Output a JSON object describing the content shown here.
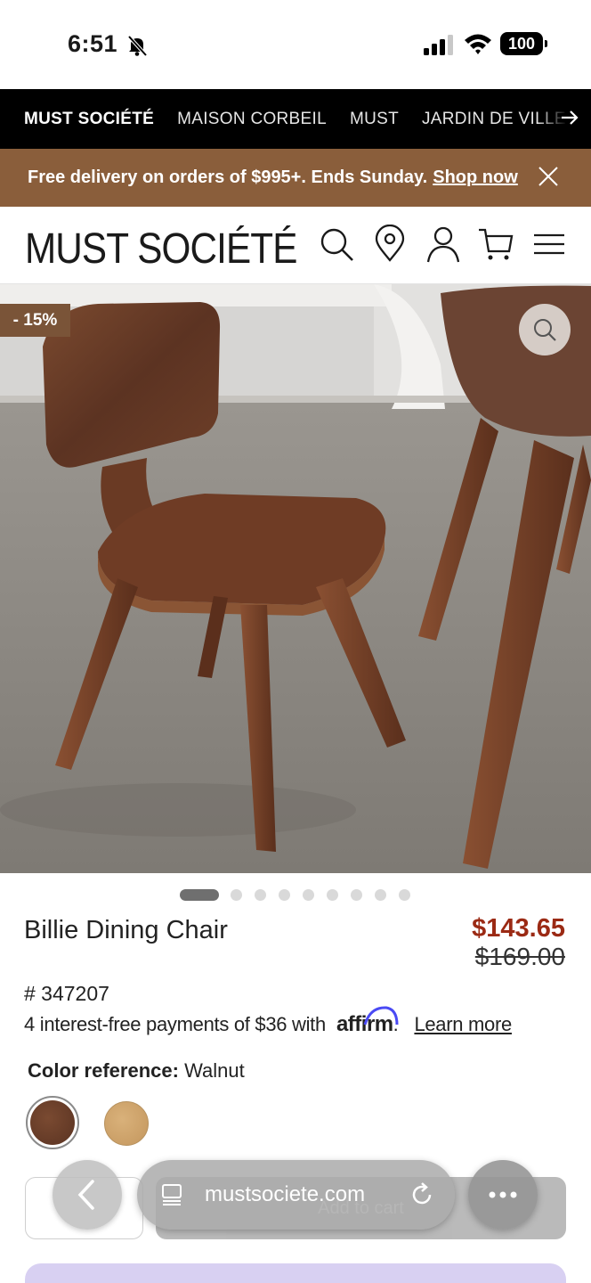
{
  "status_bar": {
    "time": "6:51",
    "battery": "100"
  },
  "brand_nav": {
    "items": [
      "MUST SOCIÉTÉ",
      "MAISON CORBEIL",
      "MUST",
      "JARDIN DE VILLE"
    ]
  },
  "promo": {
    "text": "Free delivery on orders of $995+. Ends Sunday.",
    "link": "Shop now"
  },
  "header": {
    "logo": "MUST SOCIÉTÉ"
  },
  "hero": {
    "badge": "- 15%",
    "image_count": 10,
    "active_index": 0
  },
  "product": {
    "name": "Billie Dining Chair",
    "price": "$143.65",
    "original_price": "$169.00",
    "sku": "# 347207",
    "payments_text": "4 interest-free payments of $36 with",
    "affirm_logo": "affirm",
    "learn_more": "Learn more",
    "color_label": "Color reference:",
    "color_value": "Walnut",
    "swatches": [
      {
        "name": "Walnut",
        "color": "#6a3e29",
        "selected": true
      },
      {
        "name": "Oak",
        "color": "#d3aa72",
        "selected": false
      }
    ]
  },
  "actions": {
    "add_to_cart": "Add to cart"
  },
  "browser": {
    "url": "mustsociete.com"
  },
  "colors": {
    "promo_bg": "#8a5e3b",
    "sale_price": "#9b2a14",
    "badge_bg": "#7a5438"
  }
}
